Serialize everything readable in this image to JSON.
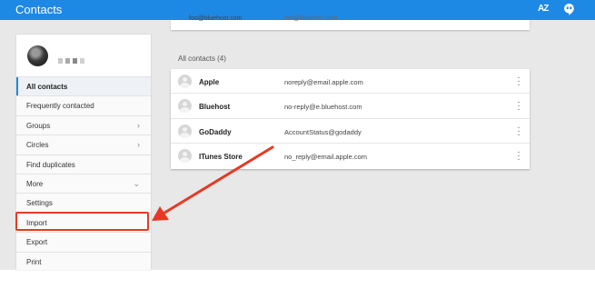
{
  "app": {
    "title": "Contacts"
  },
  "header": {
    "sort_icon": "sort-az-icon",
    "sort_label": "AZ",
    "chat_icon": "hangouts-chat-icon"
  },
  "profile": {
    "name_colors": [
      "#c8c8c8",
      "#a9a9a9",
      "#8a8a8a",
      "#d0d0d0"
    ]
  },
  "sidebar": {
    "items": [
      {
        "label": "All contacts",
        "chevron": ""
      },
      {
        "label": "Frequently contacted",
        "chevron": ""
      },
      {
        "label": "Groups",
        "chevron": "›"
      },
      {
        "label": "Circles",
        "chevron": "›"
      },
      {
        "label": "Find duplicates",
        "chevron": ""
      },
      {
        "label": "More",
        "chevron": "⌄"
      },
      {
        "label": "Settings",
        "chevron": ""
      },
      {
        "label": "Import",
        "chevron": ""
      },
      {
        "label": "Export",
        "chevron": ""
      },
      {
        "label": "Print",
        "chevron": ""
      }
    ]
  },
  "top_card": {
    "partial_name": "foo@bluehost.com",
    "partial_email": "foo@bluehost.com"
  },
  "contacts": {
    "title": "All contacts (4)",
    "rows": [
      {
        "name": "Apple",
        "email": "noreply@email.apple.com"
      },
      {
        "name": "Bluehost",
        "email": "no-reply@e.bluehost.com"
      },
      {
        "name": "GoDaddy",
        "email": "AccountStatus@godaddy"
      },
      {
        "name": "ITunes Store",
        "email": "no_reply@email.apple.com"
      }
    ]
  },
  "annotation": {
    "color": "#e53a24",
    "target": "Import"
  },
  "colors": {
    "accent": "#1e88e5",
    "background": "#e8e8e8"
  }
}
